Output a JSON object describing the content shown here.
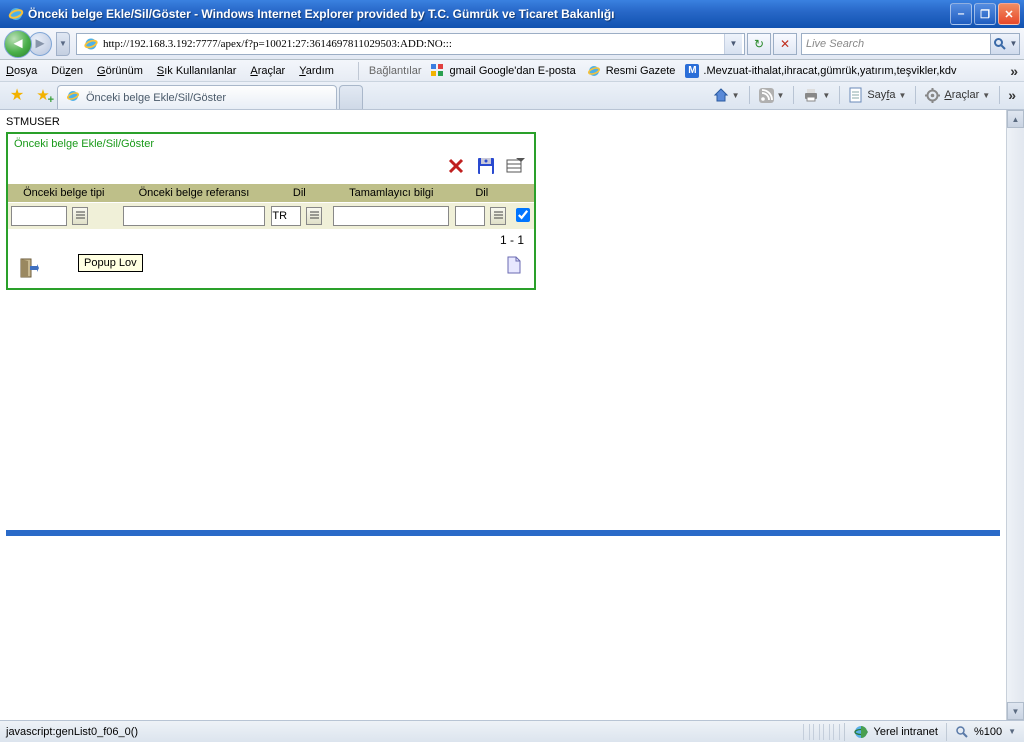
{
  "window": {
    "title": "Önceki belge Ekle/Sil/Göster - Windows Internet Explorer provided by T.C. Gümrük ve Ticaret Bakanlığı"
  },
  "address": {
    "url": "http://192.168.3.192:7777/apex/f?p=10021:27:3614697811029503:ADD:NO:::"
  },
  "search": {
    "placeholder": "Live Search"
  },
  "menu": {
    "file": "Dosya",
    "edit": "Düzen",
    "view": "Görünüm",
    "favorites": "Sık Kullanılanlar",
    "tools": "Araçlar",
    "help": "Yardım",
    "links_label": "Bağlantılar",
    "links": {
      "gmail": "gmail Google'dan E-posta",
      "gazete": "Resmi Gazete",
      "mevzuat": ".Mevzuat-ithalat,ihracat,gümrük,yatırım,teşvikler,kdv"
    }
  },
  "tabs": {
    "active": "Önceki belge Ekle/Sil/Göster"
  },
  "cmdbar": {
    "page": "Sayfa",
    "tools": "Araçlar"
  },
  "page": {
    "user": "STMUSER",
    "region_title": "Önceki belge Ekle/Sil/Göster",
    "columns": {
      "c1": "Önceki belge tipi",
      "c2": "Önceki belge referansı",
      "c3": "Dil",
      "c4": "Tamamlayıcı bilgi",
      "c5": "Dil"
    },
    "row": {
      "dil1": "TR"
    },
    "tooltip": "Popup Lov",
    "record_count": "1 - 1"
  },
  "status": {
    "script": "javascript:genList0_f06_0()",
    "zone": "Yerel intranet",
    "zoom": "%100"
  }
}
